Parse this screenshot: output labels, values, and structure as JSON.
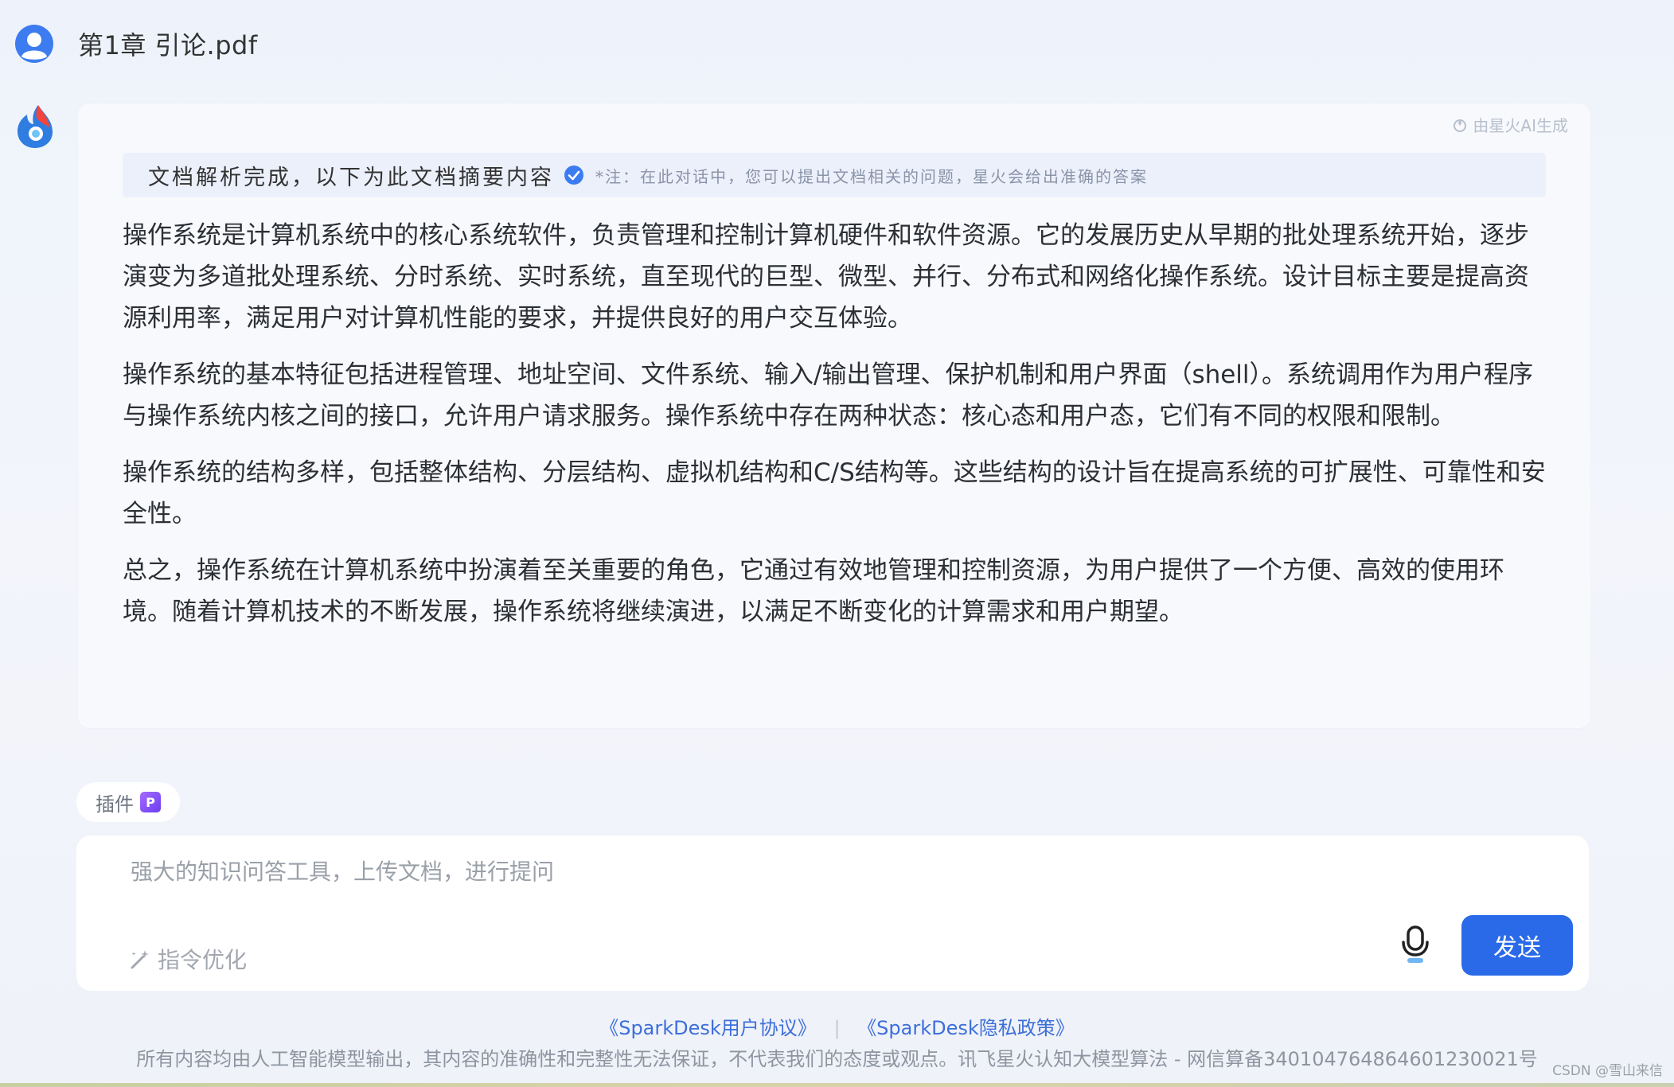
{
  "header": {
    "file_title": "第1章 引论.pdf"
  },
  "answer": {
    "ai_badge": "由星火AI生成",
    "summary_title": "文档解析完成，以下为此文档摘要内容",
    "summary_note": "*注：在此对话中，您可以提出文档相关的问题，星火会给出准确的答案",
    "paragraphs": [
      "操作系统是计算机系统中的核心系统软件，负责管理和控制计算机硬件和软件资源。它的发展历史从早期的批处理系统开始，逐步演变为多道批处理系统、分时系统、实时系统，直至现代的巨型、微型、并行、分布式和网络化操作系统。设计目标主要是提高资源利用率，满足用户对计算机性能的要求，并提供良好的用户交互体验。",
      "操作系统的基本特征包括进程管理、地址空间、文件系统、输入/输出管理、保护机制和用户界面（shell）。系统调用作为用户程序与操作系统内核之间的接口，允许用户请求服务。操作系统中存在两种状态：核心态和用户态，它们有不同的权限和限制。",
      "操作系统的结构多样，包括整体结构、分层结构、虚拟机结构和C/S结构等。这些结构的设计旨在提高系统的可扩展性、可靠性和安全性。",
      "总之，操作系统在计算机系统中扮演着至关重要的角色，它通过有效地管理和控制资源，为用户提供了一个方便、高效的使用环境。随着计算机技术的不断发展，操作系统将继续演进，以满足不断变化的计算需求和用户期望。"
    ]
  },
  "composer": {
    "plugin_label": "插件",
    "plugin_icon": "P",
    "input_placeholder": "强大的知识问答工具，上传文档，进行提问",
    "input_value": "",
    "optimize_label": "指令优化",
    "send_label": "发送"
  },
  "footer": {
    "user_agreement": "《SparkDesk用户协议》",
    "separator": "|",
    "privacy_policy": "《SparkDesk隐私政策》",
    "disclaimer": "所有内容均由人工智能模型输出，其内容的准确性和完整性无法保证，不代表我们的态度或观点。讯飞星火认知大模型算法 - 网信算备340104764864601230021号",
    "watermark": "CSDN @雪山来信"
  },
  "colors": {
    "accent": "#2a6ae8",
    "card_bg": "#f7f9fd",
    "summary_bg": "#ecf0fb",
    "link": "#3d6fd9"
  },
  "icons": {
    "user_avatar": "user-avatar-icon",
    "bot_avatar": "spark-logo-icon",
    "verified": "check-circle-icon",
    "optimize": "magic-wand-icon",
    "mic": "microphone-icon"
  }
}
